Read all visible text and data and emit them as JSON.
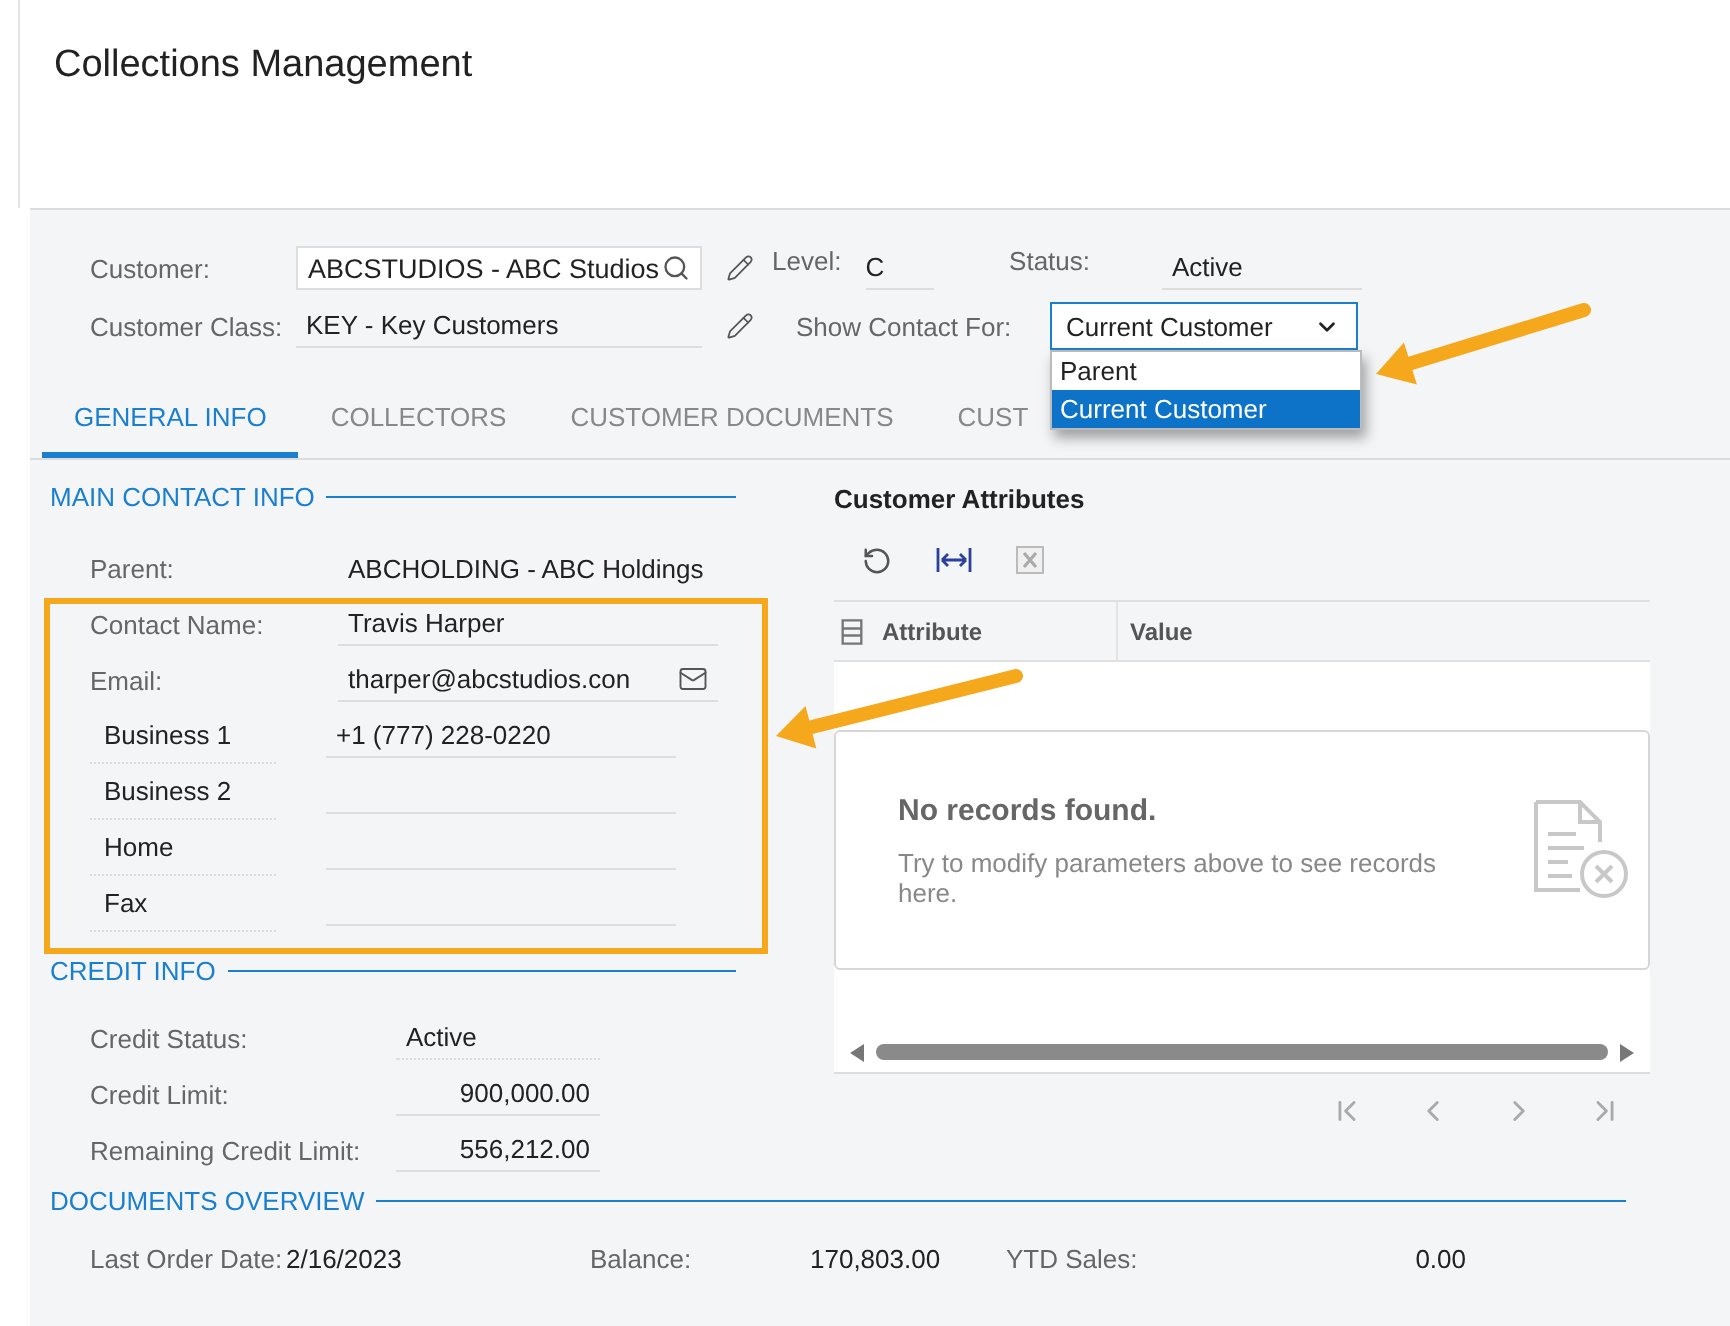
{
  "title": "Collections Management",
  "header_form": {
    "customer": {
      "label": "Customer:",
      "value": "ABCSTUDIOS - ABC Studios"
    },
    "customer_class": {
      "label": "Customer Class:",
      "value": "KEY - Key Customers"
    },
    "level": {
      "label": "Level:",
      "value": "C"
    },
    "status": {
      "label": "Status:",
      "value": "Active"
    },
    "show_contact_for": {
      "label": "Show Contact For:",
      "value": "Current Customer",
      "expanded": true,
      "options": [
        {
          "label": "Parent",
          "selected": false
        },
        {
          "label": "Current Customer",
          "selected": true
        }
      ]
    }
  },
  "tabs": [
    {
      "label": "GENERAL INFO",
      "selected": true
    },
    {
      "label": "COLLECTORS",
      "selected": false
    },
    {
      "label": "CUSTOMER DOCUMENTS",
      "selected": false
    },
    {
      "label": "CUST",
      "selected": false
    }
  ],
  "main_contact_info": {
    "title": "MAIN CONTACT INFO",
    "rows": [
      {
        "kind": "plain",
        "label": "Parent:",
        "value": "ABCHOLDING - ABC Holdings"
      },
      {
        "kind": "field",
        "label": "Contact Name:",
        "value": "Travis Harper"
      },
      {
        "kind": "email",
        "label": "Email:",
        "value": "tharper@abcstudios.con"
      },
      {
        "kind": "phone",
        "label": "Business 1",
        "value": "+1 (777) 228-0220"
      },
      {
        "kind": "phone",
        "label": "Business 2"
      },
      {
        "kind": "phone",
        "label": "Home"
      },
      {
        "kind": "phone",
        "label": "Fax"
      }
    ]
  },
  "credit_info": {
    "title": "CREDIT INFO",
    "rows": [
      {
        "kind": "text",
        "label": "Credit Status:",
        "value": "Active"
      },
      {
        "kind": "amount",
        "label": "Credit Limit:",
        "value": "900,000.00"
      },
      {
        "kind": "amount",
        "label": "Remaining Credit Limit:",
        "value": "556,212.00"
      }
    ]
  },
  "customer_attributes": {
    "title": "Customer Attributes",
    "columns": [
      "Attribute",
      "Value"
    ],
    "empty_title": "No records found.",
    "empty_text": "Try to modify parameters above to see records here."
  },
  "documents_overview": {
    "title": "DOCUMENTS OVERVIEW",
    "items": [
      {
        "label": "Last Order Date:",
        "value": "2/16/2023"
      },
      {
        "label": "Balance:",
        "value": "170,803.00"
      },
      {
        "label": "YTD Sales:",
        "value": "0.00"
      }
    ]
  }
}
